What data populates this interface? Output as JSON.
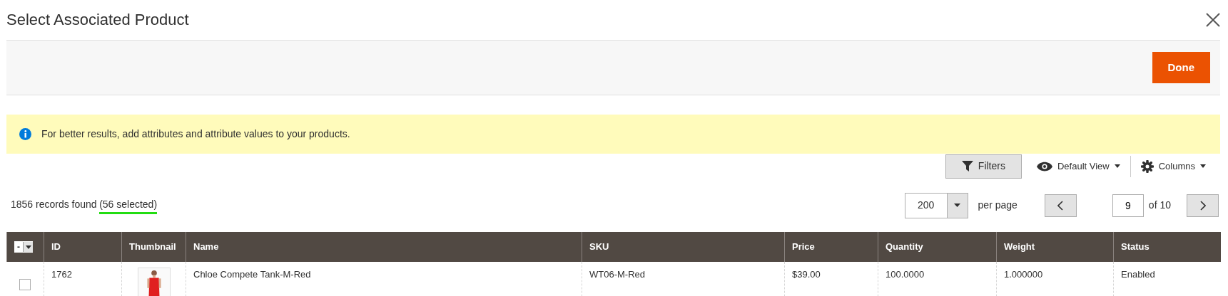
{
  "window": {
    "title": "Select Associated Product"
  },
  "action_bar": {
    "buttons": [
      "Done"
    ]
  },
  "notice": {
    "text": "For better results, add attributes and attribute values to your products."
  },
  "grid_toolbar": {
    "filters": "Filters",
    "view": "Default View",
    "columns": "Columns"
  },
  "records": {
    "found": "1856 records found",
    "selected_count": "(56 selected)"
  },
  "pagination": {
    "per_page_value": "200",
    "per_page_label": "per page",
    "page": "9",
    "of_pages": "of 10"
  },
  "table": {
    "mass_select": "-",
    "columns": [
      "ID",
      "Thumbnail",
      "Name",
      "SKU",
      "Price",
      "Quantity",
      "Weight",
      "Status"
    ],
    "rows": [
      {
        "checked": false,
        "cells": [
          "1762",
          "",
          "Chloe Compete Tank-M-Red",
          "WT06-M-Red",
          "$39.00",
          "100.0000",
          "1.000000",
          "Enabled"
        ]
      }
    ]
  }
}
